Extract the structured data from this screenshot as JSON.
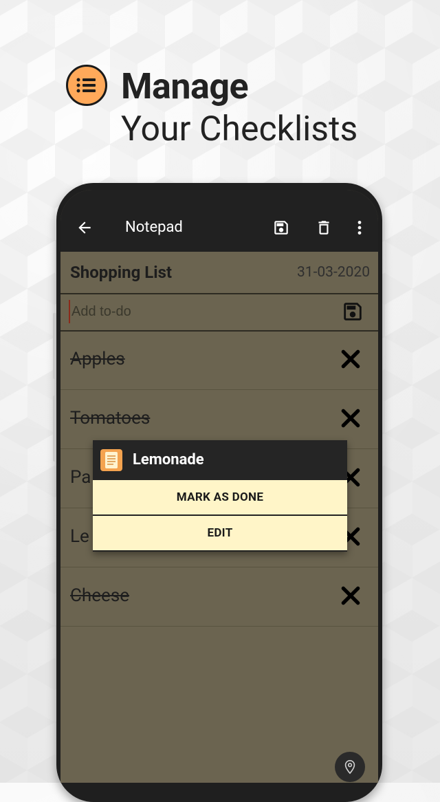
{
  "promo": {
    "icon": "list-icon",
    "title": "Manage",
    "subtitle": "Your Checklists",
    "accent": "#ffa95a"
  },
  "appbar": {
    "title": "Notepad",
    "icons": [
      "back-arrow-icon",
      "save-icon",
      "delete-icon",
      "more-vert-icon"
    ]
  },
  "note": {
    "title": "Shopping List",
    "date": "31-03-2020",
    "add_placeholder": "Add to-do"
  },
  "items": [
    {
      "label": "Apples",
      "done": true
    },
    {
      "label": "Tomatoes",
      "done": true
    },
    {
      "label": "Pa",
      "done": false
    },
    {
      "label": "Le",
      "done": false
    },
    {
      "label": "Cheese",
      "done": true
    }
  ],
  "popup": {
    "title": "Lemonade",
    "mark_done_label": "MARK AS DONE",
    "edit_label": "EDIT"
  },
  "colors": {
    "screen_bg": "#6b6450",
    "appbar_bg": "#212121",
    "popup_button_bg": "#fff5c8"
  }
}
